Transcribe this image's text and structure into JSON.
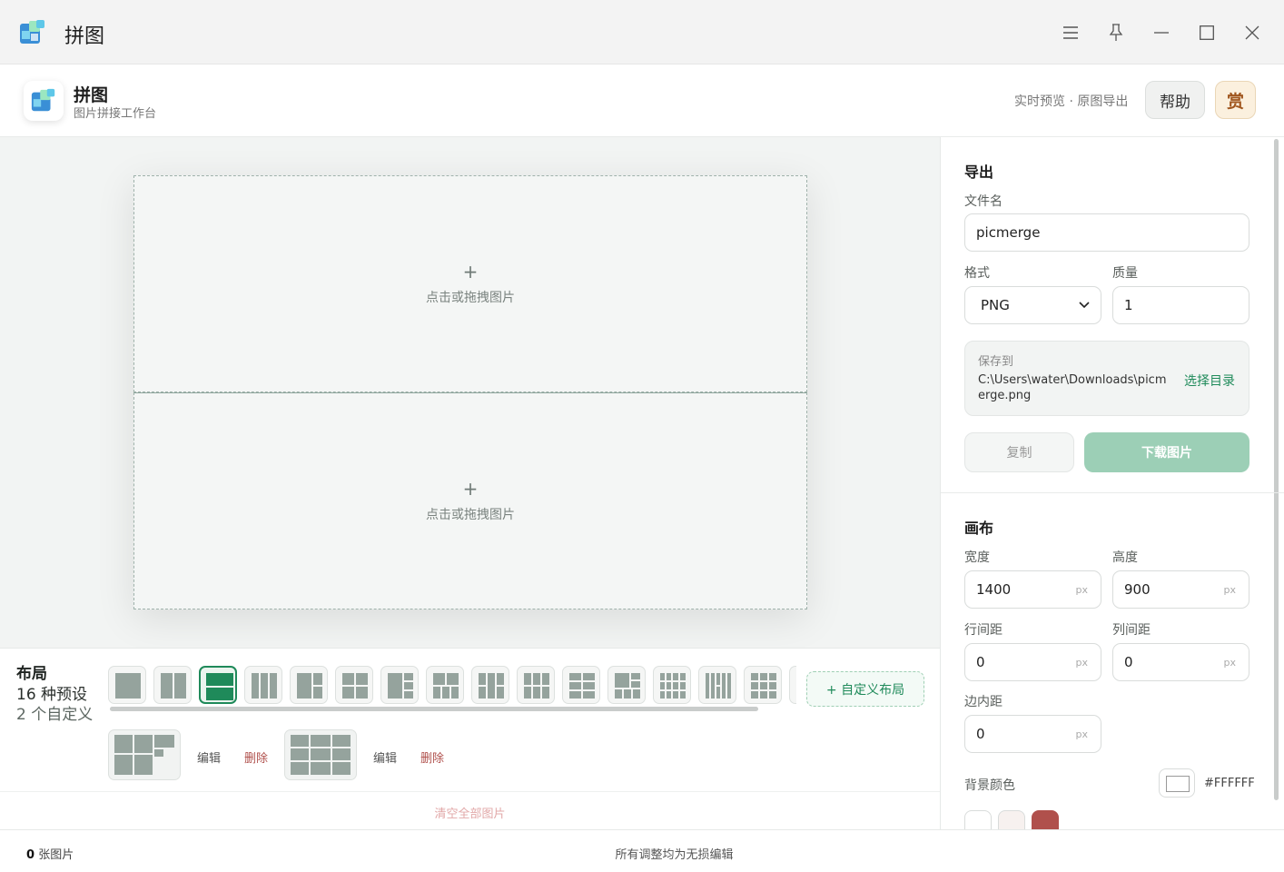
{
  "window": {
    "title": "拼图"
  },
  "header": {
    "title": "拼图",
    "subtitle": "图片拼接工作台",
    "tagline": "实时预览 · 原图导出",
    "help_label": "帮助",
    "reward_label": "赏"
  },
  "canvas": {
    "cells": [
      {
        "plus": "+",
        "hint": "点击或拖拽图片"
      },
      {
        "plus": "+",
        "hint": "点击或拖拽图片"
      }
    ]
  },
  "layout": {
    "title": "布局",
    "preset_count": "16 种预设",
    "custom_count": "2 个自定义",
    "selected_preset": 3,
    "custom_button": "+ 自定义布局",
    "edit_label": "编辑",
    "delete_label": "删除"
  },
  "clear_all": "清空全部图片",
  "status": {
    "count": "0",
    "count_suffix": "张图片",
    "note": "所有调整均为无损编辑"
  },
  "export": {
    "title": "导出",
    "filename_label": "文件名",
    "filename": "picmerge",
    "format_label": "格式",
    "format": "PNG",
    "quality_label": "质量",
    "quality": "1",
    "save_label": "保存到",
    "save_path": "C:\\Users\\water\\Downloads\\picmerge.png",
    "choose_dir": "选择目录",
    "copy_label": "复制",
    "download_label": "下载图片"
  },
  "canvas_settings": {
    "title": "画布",
    "width_label": "宽度",
    "width": "1400",
    "height_label": "高度",
    "height": "900",
    "row_gap_label": "行间距",
    "row_gap": "0",
    "col_gap_label": "列间距",
    "col_gap": "0",
    "padding_label": "边内距",
    "padding": "0",
    "unit": "px",
    "bg_label": "背景颜色",
    "bg_hex": "#FFFFFF",
    "bg_presets": [
      "#ffffff",
      "#f7f1ef",
      "#b0504c"
    ]
  },
  "colors": {
    "accent": "#1f8a5a",
    "accent_light": "#9ccfb6",
    "danger": "#b0504c"
  }
}
